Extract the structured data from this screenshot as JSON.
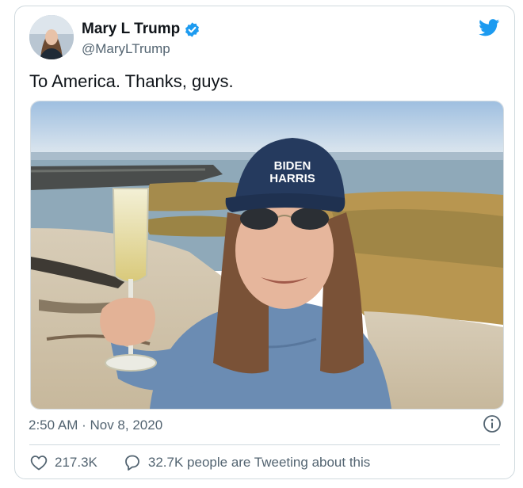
{
  "author": {
    "display_name": "Mary L Trump",
    "handle": "@MaryLTrump",
    "verified": true
  },
  "tweet": {
    "text": "To America. Thanks, guys.",
    "timestamp": "2:50 AM · Nov 8, 2020"
  },
  "photo": {
    "cap_text_line1": "BIDEN",
    "cap_text_line2": "HARRIS"
  },
  "stats": {
    "likes": "217.3K",
    "conversation": "32.7K people are Tweeting about this"
  },
  "colors": {
    "brand": "#1d9bf0",
    "text_primary": "#0f1419",
    "text_secondary": "#536471",
    "border": "#cfd9de"
  },
  "icons": {
    "bird": "twitter-bird-icon",
    "verified": "verified-badge-icon",
    "info": "info-icon",
    "like": "heart-icon",
    "reply": "speech-bubble-icon"
  }
}
